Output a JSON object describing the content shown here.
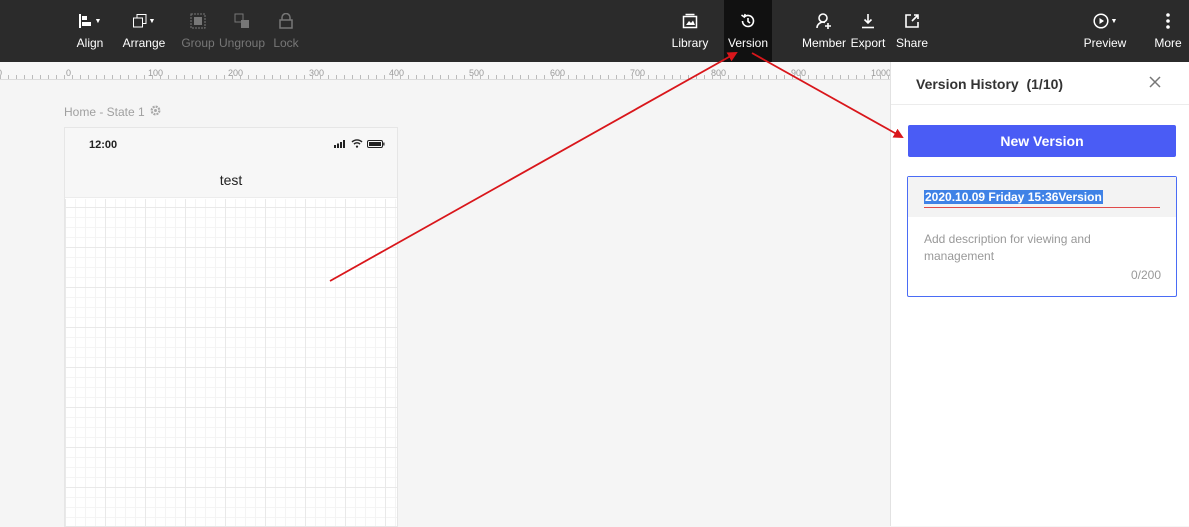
{
  "toolbar": {
    "align": "Align",
    "arrange": "Arrange",
    "group": "Group",
    "ungroup": "Ungroup",
    "lock": "Lock",
    "library": "Library",
    "version": "Version",
    "member": "Member",
    "export": "Export",
    "share": "Share",
    "preview": "Preview",
    "more": "More"
  },
  "ruler": {
    "labels": [
      "0",
      "0",
      "100",
      "200",
      "300",
      "400",
      "500",
      "600",
      "700",
      "800",
      "900",
      "1000"
    ]
  },
  "canvas": {
    "state_label": "Home - State 1",
    "phone_time": "12:00",
    "page_title": "test"
  },
  "version_panel": {
    "title": "Version History  (1/10)",
    "new_version": "New Version",
    "version_name": "2020.10.09 Friday 15:36Version",
    "description_placeholder": "Add description for viewing and management",
    "char_count": "0/200"
  },
  "colors": {
    "toolbar_bg": "#2b2b2b",
    "accent": "#4a5cf5",
    "annotation_arrow": "#d9161b"
  }
}
